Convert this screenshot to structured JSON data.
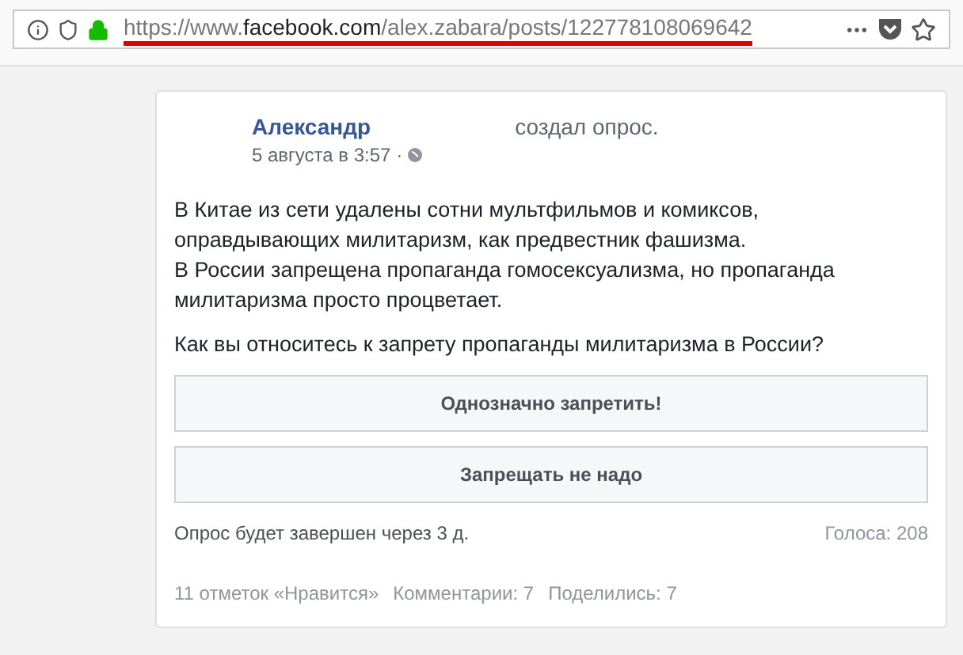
{
  "address_bar": {
    "url_prefix": "https://www.",
    "url_domain": "facebook.com",
    "url_path": "/alex.zabara/posts/122778108069642",
    "highlighted": true
  },
  "post": {
    "author": "Александр",
    "action": "создал опрос.",
    "time": "5 августа в 3:57 ·",
    "paragraphs": [
      [
        "В Китае из сети удалены сотни мультфильмов и комиксов,",
        "оправдывающих милитаризм, как предвестник фашизма.",
        "В России запрещена пропаганда гомосексуализма, но пропаганда",
        "милитаризма просто процветает."
      ],
      [
        "Как вы относитесь к запрету пропаганды милитаризма в России?"
      ]
    ],
    "options": [
      {
        "label": "Однозначно запретить!"
      },
      {
        "label": "Запрещать не надо"
      }
    ],
    "poll_status": "Опрос будет завершен через 3 д.",
    "votes": "Голоса: 208",
    "stats": [
      "11 отметок «Нравится»",
      "Комментарии: 7",
      "Поделились: 7"
    ]
  }
}
